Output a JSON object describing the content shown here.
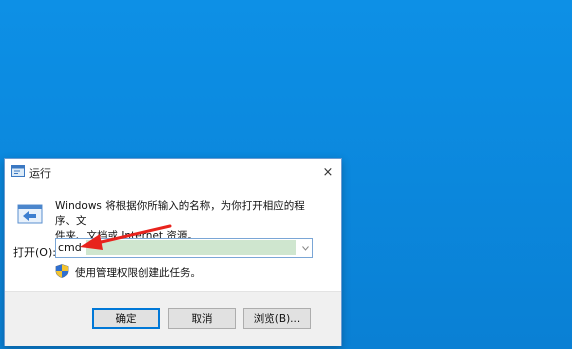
{
  "desktop": {
    "background_color": "#0b88df"
  },
  "dialog": {
    "title": "运行",
    "close_icon": "×",
    "description_line1": "Windows 将根据你所输入的名称，为你打开相应的程序、文",
    "description_line2": "件夹、文档或 Internet 资源。",
    "open_label": "打开(O):",
    "input_value": "cmd",
    "admin_note": "使用管理权限创建此任务。",
    "buttons": {
      "ok": "确定",
      "cancel": "取消",
      "browse": "浏览(B)..."
    },
    "icons": {
      "title": "run-app-icon",
      "run": "run-window-icon",
      "shield": "uac-shield-icon",
      "dropdown": "chevron-down-icon"
    },
    "annotation_arrow_color": "#e8231d"
  }
}
